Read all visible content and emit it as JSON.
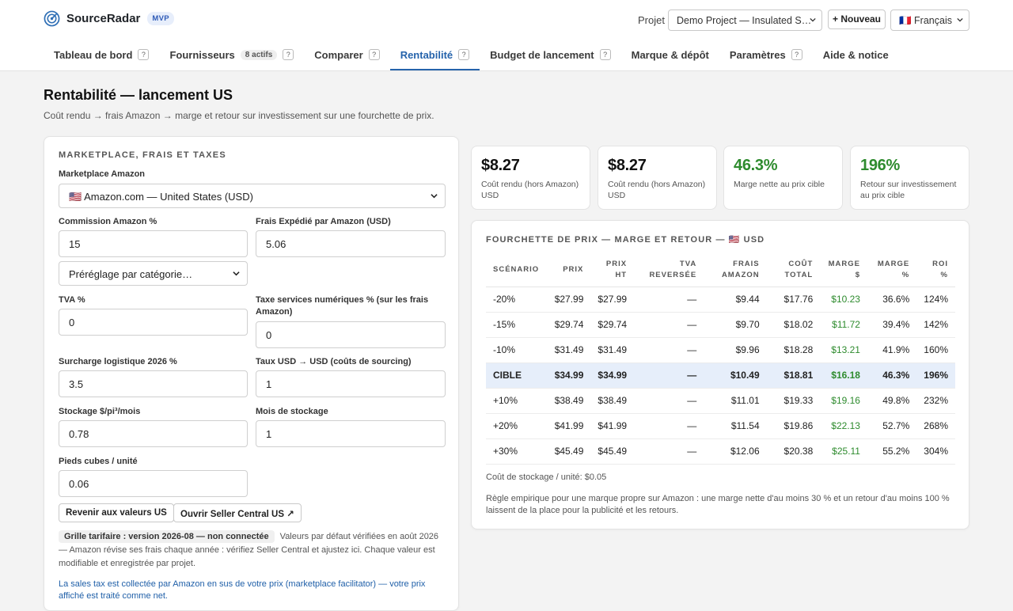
{
  "header": {
    "brand": "SourceRadar",
    "badge": "MVP",
    "project_label": "Projet",
    "project_value": "Demo Project — Insulated S…",
    "new_button": "+ Nouveau",
    "language": "🇫🇷 Français"
  },
  "tabs": [
    {
      "label": "Tableau de bord",
      "help": "?"
    },
    {
      "label": "Fournisseurs",
      "count": "8 actifs",
      "help": "?"
    },
    {
      "label": "Comparer",
      "help": "?"
    },
    {
      "label": "Rentabilité",
      "help": "?",
      "active": true
    },
    {
      "label": "Budget de lancement",
      "help": "?"
    },
    {
      "label": "Marque & dépôt"
    },
    {
      "label": "Paramètres",
      "help": "?"
    },
    {
      "label": "Aide & notice"
    }
  ],
  "page": {
    "title": "Rentabilité — lancement US",
    "subtitle": "Coût rendu → frais Amazon → marge et retour sur investissement sur une fourchette de prix."
  },
  "form": {
    "section_title": "MARKETPLACE, FRAIS ET TAXES",
    "marketplace_label": "Marketplace Amazon",
    "marketplace_value": "🇺🇸 Amazon.com — United States (USD)",
    "commission_label": "Commission Amazon %",
    "commission_value": "15",
    "fba_label": "Frais Expédié par Amazon (USD)",
    "fba_value": "5.06",
    "preset_value": "Préréglage par catégorie…",
    "vat_label": "TVA %",
    "vat_value": "0",
    "dst_label": "Taxe services numériques % (sur les frais Amazon)",
    "dst_value": "0",
    "surcharge_label": "Surcharge logistique 2026 %",
    "surcharge_value": "3.5",
    "fx_label": "Taux USD → USD (coûts de sourcing)",
    "fx_value": "1",
    "storage_label": "Stockage $/pi³/mois",
    "storage_value": "0.78",
    "months_label": "Mois de stockage",
    "months_value": "1",
    "cubic_label": "Pieds cubes / unité",
    "cubic_value": "0.06",
    "reset_button": "Revenir aux valeurs US",
    "seller_button": "Ouvrir Seller Central US ↗",
    "note_badge": "Grille tarifaire : version 2026-08 — non connectée",
    "note_text": "Valeurs par défaut vérifiées en août 2026 — Amazon révise ses frais chaque année : vérifiez Seller Central et ajustez ici. Chaque valeur est modifiable et enregistrée par projet.",
    "tax_note": "La sales tax est collectée par Amazon en sus de votre prix (marketplace facilitator) — votre prix affiché est traité comme net."
  },
  "stats": [
    {
      "value": "$8.27",
      "label": "Coût rendu (hors Amazon) USD",
      "color": "#111111"
    },
    {
      "value": "$8.27",
      "label": "Coût rendu (hors Amazon) USD",
      "color": "#111111"
    },
    {
      "value": "46.3%",
      "label": "Marge nette au prix cible",
      "color": "#2e8b2e"
    },
    {
      "value": "196%",
      "label": "Retour sur investissement au prix cible",
      "color": "#2e8b2e"
    }
  ],
  "table": {
    "title": "FOURCHETTE DE PRIX — MARGE ET RETOUR — 🇺🇸 USD",
    "headers": [
      "SCÉNARIO",
      "PRIX",
      "PRIX HT",
      "TVA REVERSÉE",
      "FRAIS AMAZON",
      "COÛT TOTAL",
      "MARGE $",
      "MARGE %",
      "ROI %"
    ],
    "rows": [
      [
        "-20%",
        "$27.99",
        "$27.99",
        "—",
        "$9.44",
        "$17.76",
        "$10.23",
        "36.6%",
        "124%"
      ],
      [
        "-15%",
        "$29.74",
        "$29.74",
        "—",
        "$9.70",
        "$18.02",
        "$11.72",
        "39.4%",
        "142%"
      ],
      [
        "-10%",
        "$31.49",
        "$31.49",
        "—",
        "$9.96",
        "$18.28",
        "$13.21",
        "41.9%",
        "160%"
      ],
      [
        "CIBLE",
        "$34.99",
        "$34.99",
        "—",
        "$10.49",
        "$18.81",
        "$16.18",
        "46.3%",
        "196%"
      ],
      [
        "+10%",
        "$38.49",
        "$38.49",
        "—",
        "$11.01",
        "$19.33",
        "$19.16",
        "49.8%",
        "232%"
      ],
      [
        "+20%",
        "$41.99",
        "$41.99",
        "—",
        "$11.54",
        "$19.86",
        "$22.13",
        "52.7%",
        "268%"
      ],
      [
        "+30%",
        "$45.49",
        "$45.49",
        "—",
        "$12.06",
        "$20.38",
        "$25.11",
        "55.2%",
        "304%"
      ]
    ],
    "highlight_row": 3,
    "storage_cost": "Coût de stockage / unité: $0.05",
    "rule_note": "Règle empirique pour une marque propre sur Amazon : une marge nette d'au moins 30 % et un retour d'au moins 100 % laissent de la place pour la publicité et les retours."
  },
  "colors": {
    "accent": "#2563ab",
    "positive": "#2e8b2e",
    "highlight_row": "#e6eefa"
  }
}
